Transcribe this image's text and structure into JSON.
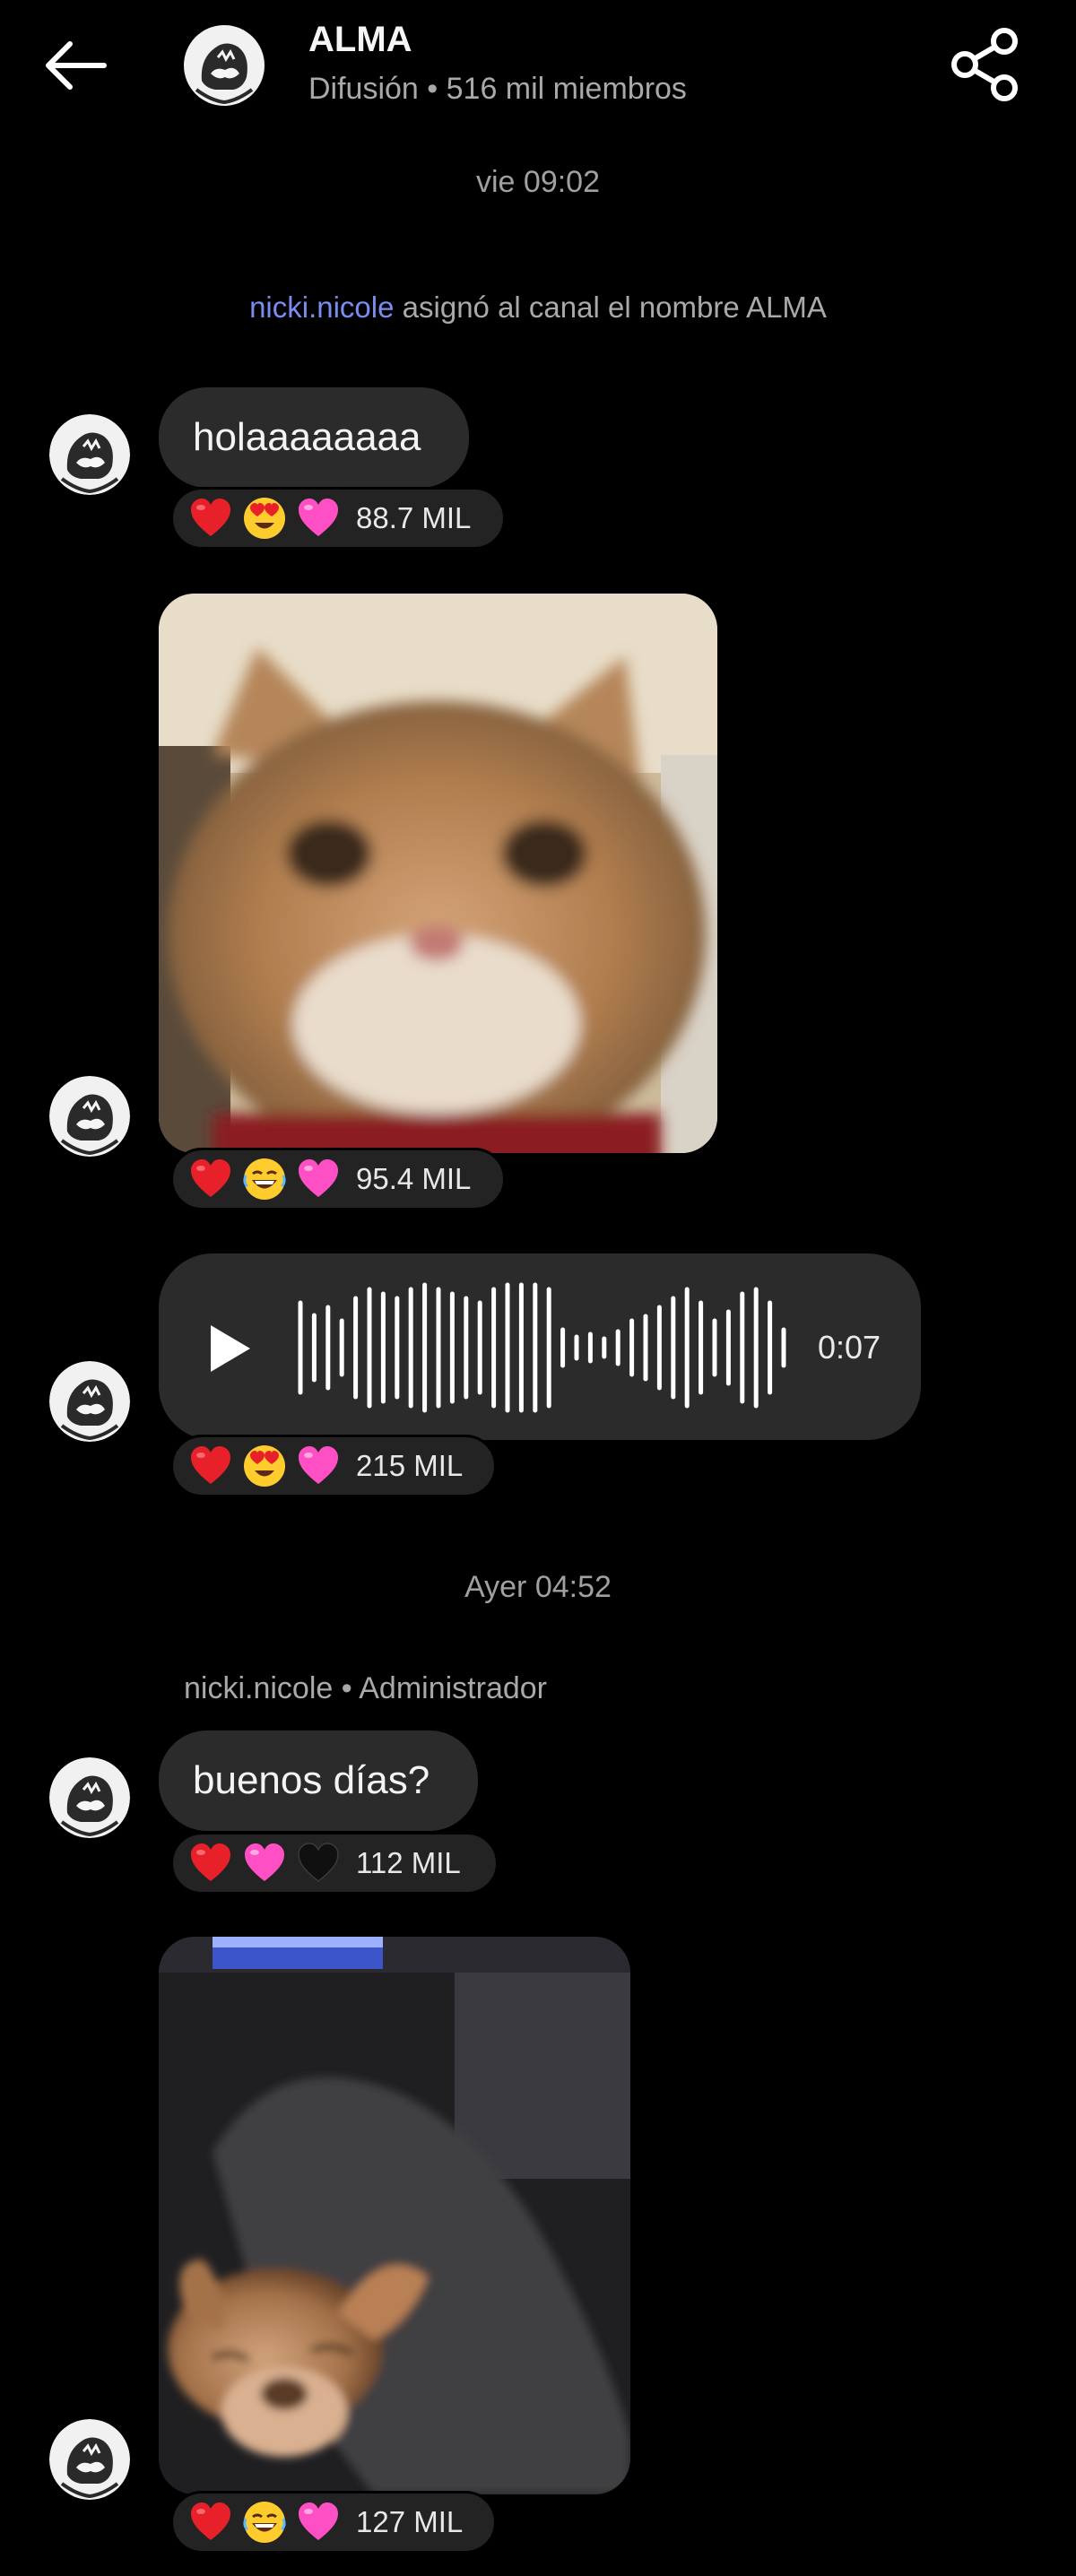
{
  "header": {
    "title": "ALMA",
    "subtitle": "Difusión • 516 mil miembros"
  },
  "timestamps": {
    "first": "vie 09:02",
    "second": "Ayer 04:52"
  },
  "system_message": {
    "user": "nicki.nicole",
    "text": " asignó al canal el nombre ALMA"
  },
  "sender": {
    "name": "nicki.nicole",
    "role": "Administrador"
  },
  "messages": [
    {
      "type": "text",
      "text": "holaaaaaaaa",
      "reactions": [
        "heart-icon",
        "heart-eyes-icon",
        "pink-heart-icon"
      ],
      "count": "88.7 MIL"
    },
    {
      "type": "image",
      "content": "cat photo",
      "reactions": [
        "heart-icon",
        "laughing-icon",
        "pink-heart-icon"
      ],
      "count": "95.4 MIL"
    },
    {
      "type": "audio",
      "duration": "0:07",
      "reactions": [
        "heart-icon",
        "heart-eyes-icon",
        "pink-heart-icon"
      ],
      "count": "215 MIL"
    },
    {
      "type": "text",
      "text": "buenos días?",
      "reactions": [
        "heart-icon",
        "pink-heart-icon",
        "black-heart-icon"
      ],
      "count": "112 MIL"
    },
    {
      "type": "image",
      "content": "dog photo",
      "reactions": [
        "heart-icon",
        "laughing-icon",
        "pink-heart-icon"
      ],
      "count": "127 MIL"
    }
  ],
  "colors": {
    "background": "#000000",
    "bubble": "#2b2b2b",
    "link_user": "#7a8cf0",
    "muted_text": "#a9a9a9"
  }
}
